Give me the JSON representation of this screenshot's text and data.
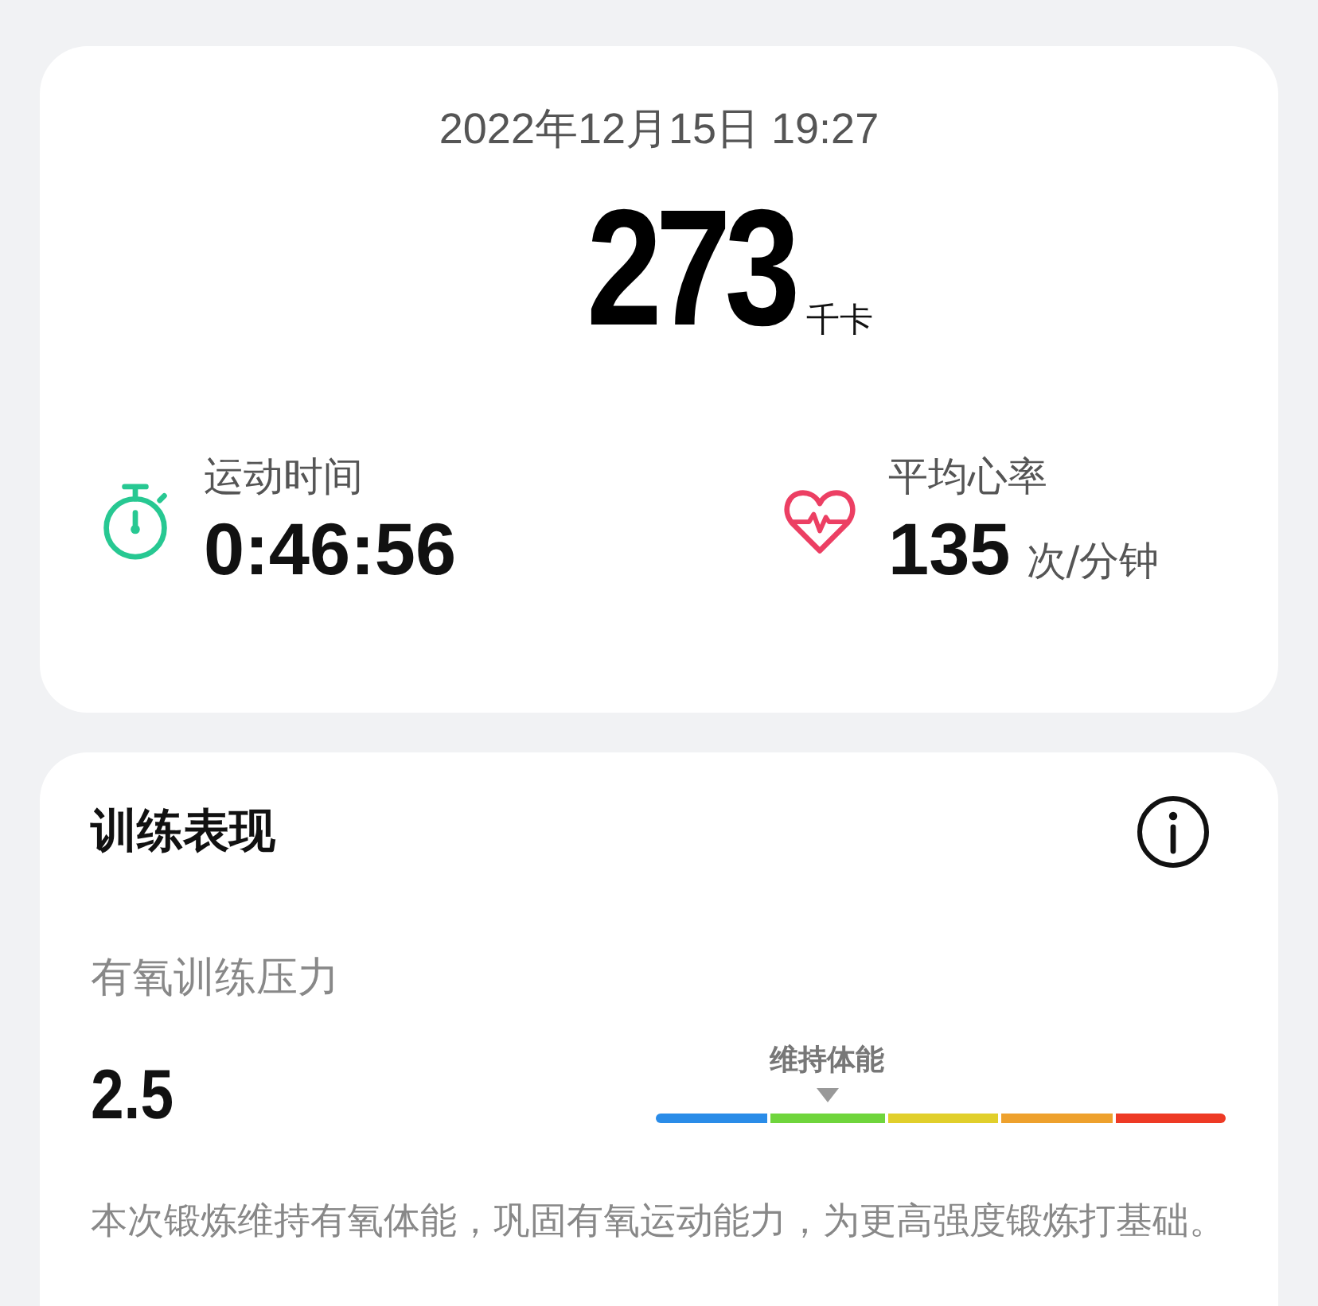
{
  "summary": {
    "datetime": "2022年12月15日 19:27",
    "calories": "273",
    "calories_unit": "千卡",
    "stats": [
      {
        "kind": "timer",
        "label": "运动时间",
        "value": "0:46:56"
      },
      {
        "kind": "heart",
        "label": "平均心率",
        "value": "135",
        "unit": "次/分钟"
      }
    ]
  },
  "performance": {
    "title": "训练表现",
    "metric_label": "有氧训练压力",
    "metric_value": "2.5",
    "scale": {
      "label": "维持体能",
      "segments": [
        {
          "color": "#2a8ce8",
          "selected": false
        },
        {
          "color": "#6fd53c",
          "selected": true
        },
        {
          "color": "#e1cf2b",
          "selected": false
        },
        {
          "color": "#eea12d",
          "selected": false
        },
        {
          "color": "#ee3a25",
          "selected": false
        }
      ]
    },
    "description": "本次锻炼维持有氧体能，巩固有氧运动能力，为更高强度锻炼打基础。"
  }
}
